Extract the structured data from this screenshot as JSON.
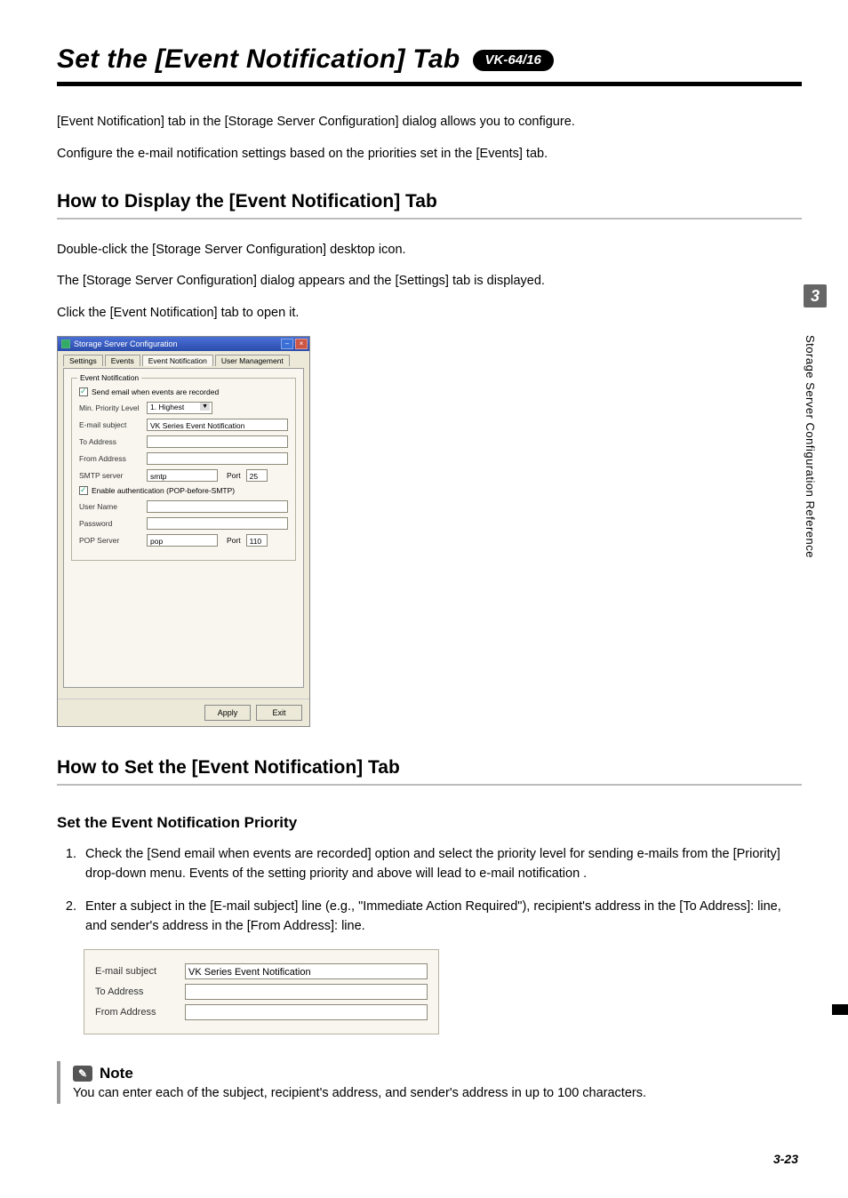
{
  "title": "Set the [Event Notification] Tab",
  "badge": "VK-64/16",
  "intro1_pre": "[",
  "intro1_a": "Event Notification",
  "intro1_mid": "] tab in the [",
  "intro1_b": "Storage Server Configuration",
  "intro1_post": "] dialog allows you to configure.",
  "intro2": "Configure the e-mail notification settings based on the priorities set in the [Events] tab.",
  "h2_display": "How to Display the [Event Notification] Tab",
  "disp1_a": "Double-click the [",
  "disp1_b": "Storage Server Configuration",
  "disp1_c": "] desktop icon.",
  "disp2_a": "The [",
  "disp2_b": "Storage Server Configuration",
  "disp2_c": "] dialog appears and the [",
  "disp2_d": "Settings",
  "disp2_e": "] tab is displayed.",
  "disp3_a": "Click the [",
  "disp3_b": "Event Notification",
  "disp3_c": "] tab to open it.",
  "dialog": {
    "title": "Storage Server Configuration",
    "tabs": {
      "settings": "Settings",
      "events": "Events",
      "event_notification": "Event Notification",
      "user_mgmt": "User Management"
    },
    "legend": "Event Notification",
    "chk_send": "Send email when events are recorded",
    "min_priority_label": "Min. Priority Level",
    "min_priority_value": "1. Highest",
    "email_subject_label": "E-mail subject",
    "email_subject_value": "VK Series Event Notification",
    "to_label": "To Address",
    "from_label": "From Address",
    "smtp_label": "SMTP server",
    "smtp_value": "smtp",
    "port_label": "Port",
    "smtp_port_value": "25",
    "chk_auth": "Enable authentication (POP-before-SMTP)",
    "user_label": "User Name",
    "pass_label": "Password",
    "pop_label": "POP Server",
    "pop_value": "pop",
    "pop_port_value": "110",
    "apply": "Apply",
    "exit": "Exit"
  },
  "h2_set": "How to Set the [Event Notification] Tab",
  "h3_priority": "Set the Event Notification Priority",
  "step1": "Check the [Send email when events are recorded] option and select the priority level for sending e-mails from the [Priority] drop-down menu. Events of the setting priority and above will lead to e-mail notification .",
  "step2": "Enter a subject in the [E-mail subject] line (e.g., \"Immediate Action Required\"), recipient's address in the [To Address]: line, and sender's address in the [From Address]: line.",
  "inset": {
    "email_subject_label": "E-mail subject",
    "email_subject_value": "VK Series Event Notification",
    "to_label": "To Address",
    "from_label": "From Address"
  },
  "note_head": "Note",
  "note_body": "You can enter each of the subject, recipient's address, and sender's address in up to 100 characters.",
  "side_num": "3",
  "side_text": "Storage Server Configuration Reference",
  "page_number": "3-23"
}
